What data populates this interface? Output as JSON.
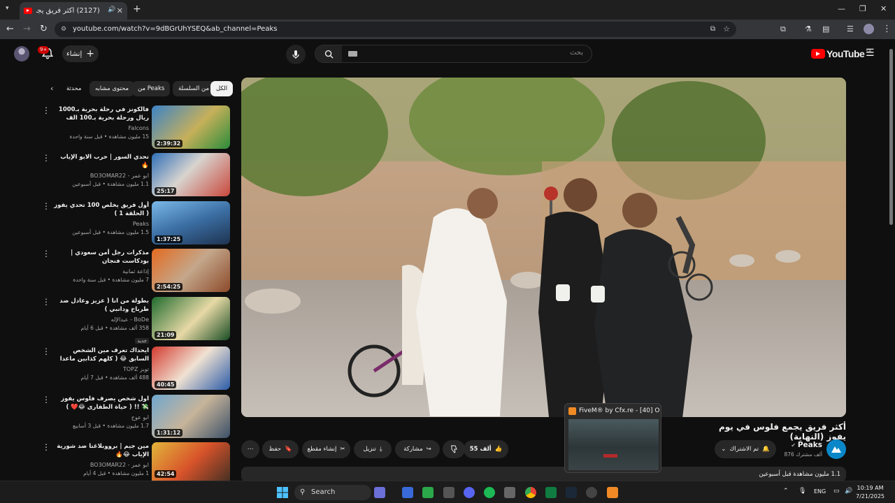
{
  "browser": {
    "tab_title": "(2127) أكثر فريق يجمع فلوس",
    "url": "youtube.com/watch?v=9dBGrUhYSEQ&ab_channel=Peaks"
  },
  "header": {
    "create_label": "إنشاء",
    "notification_count": "9+",
    "search_placeholder": "بحث",
    "logo_text": "YouTube",
    "country_code": "SA"
  },
  "chips": {
    "all": "الكل",
    "from_series": "من السلسلة",
    "from_peaks": "من Peaks",
    "similar": "محتوى مشابه",
    "watched": "محدثة"
  },
  "related": [
    {
      "title": "فالكونز في رحلة بحرية بـ1000 ريال ورحلة بحرية بـ100 الف ريال 🔥🌊",
      "channel": "Falcons",
      "views": "15 مليون مشاهدة • قبل سنة واحدة",
      "duration": "2:39:32"
    },
    {
      "title": "تحدي السور | حرب الابو الإياب 🔥",
      "channel": "ابو عمر - BO3OMAR22",
      "views": "1.1 مليون مشاهدة • قبل أسبوعين",
      "duration": "25:17"
    },
    {
      "title": "أول فريق يخلص 100 تحدي يفوز ( الحلقة 1 )",
      "channel": "Peaks",
      "views": "1.5 مليون مشاهدة • قبل أسبوعين",
      "duration": "1:37:25"
    },
    {
      "title": "مذكرات رجل أمن سعودي | بودكاست فنجان",
      "channel": "إذاعة ثمانية",
      "views": "7 مليون مشاهدة • قبل سنة واحدة",
      "duration": "2:54:25"
    },
    {
      "title": "بطولة من انا ( عزيز وعادل ضد طرباخ ودانبي )",
      "channel": "BoDe - عبدالإله",
      "views": "358 ألف مشاهدة • قبل 6 أيام",
      "duration": "21:09",
      "badge": "جديد"
    },
    {
      "title": "ايحداك تعرف مين الشخص السابق 😂 ( كلهم كذابين ماعدا شخص واحد 🤯 !!!)",
      "channel": "توبز TOPZ",
      "views": "488 ألف مشاهدة • قبل 7 أيام",
      "duration": "40:45"
    },
    {
      "title": "اول شخص يصرف فلوس يفوز 💸 !! ( حياة الطفارى 😂❤️ )",
      "channel": "ابو عوج",
      "views": "1.7 مليون مشاهدة • قبل 3 أسابيع",
      "duration": "1:31:12"
    },
    {
      "title": "مين جيم | برووبلاغنا ضد شورية الإياب 😂🔥",
      "channel": "ابو عمر - BO3OMAR22",
      "views": "1 مليون مشاهدة • قبل 4 أيام",
      "duration": "42:54"
    }
  ],
  "video": {
    "title": "أكثر فريق يجمع فلوس في يوم يفوز (النهاية)",
    "channel": "Peaks",
    "subscribers": "876 ألف مشترك",
    "subscribed_label": "تم الاشتراك",
    "likes": "55 ألف",
    "share": "مشاركة",
    "download": "تنزيل",
    "clip": "إنشاء مقطع",
    "save": "حفظ",
    "description_meta": "1.1 مليون مشاهدة قبل أسبوعين"
  },
  "preview": {
    "title": "FiveM® by Cfx.re - [40] Ou..."
  },
  "taskbar": {
    "search": "Search",
    "lang": "ENG",
    "time": "10:19 AM",
    "date": "7/21/2025"
  },
  "colors": {
    "youtube_red": "#ff0000",
    "bg": "#0f0f0f",
    "chip_bg": "#272727"
  }
}
